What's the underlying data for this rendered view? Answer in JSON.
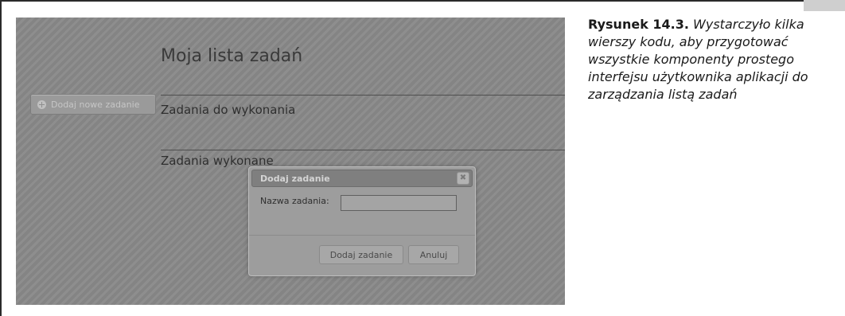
{
  "app": {
    "title": "Moja lista zadań",
    "add_task_button": "Dodaj nowe zadanie",
    "sections": [
      {
        "heading": "Zadania do wykonania"
      },
      {
        "heading": "Zadania wykonane"
      }
    ]
  },
  "dialog": {
    "title": "Dodaj zadanie",
    "close_glyph": "✖",
    "field_label": "Nazwa zadania:",
    "field_value": "",
    "confirm_button": "Dodaj zadanie",
    "cancel_button": "Anuluj"
  },
  "caption": {
    "label": "Rysunek 14.3.",
    "text": "Wystarczyło kilka wierszy kodu, aby przygotować wszystkie komponenty prostego interfejsu użytkownika aplikacji do zarządzania listą zadań"
  },
  "icons": {
    "add_task": "plus-circle-icon",
    "close": "close-icon"
  }
}
